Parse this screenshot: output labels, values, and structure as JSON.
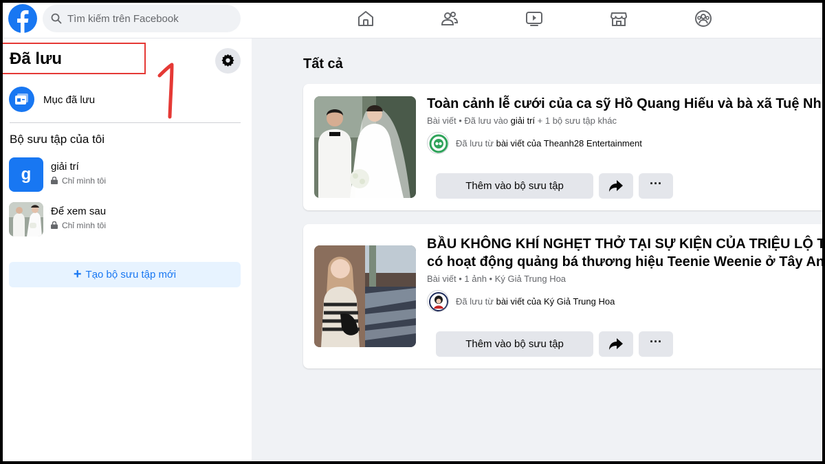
{
  "search": {
    "placeholder": "Tìm kiếm trên Facebook"
  },
  "nav": [
    "home-icon",
    "friends-icon",
    "watch-icon",
    "marketplace-icon",
    "groups-icon"
  ],
  "sidebar": {
    "title": "Đã lưu",
    "annotation_number": "1",
    "saved_items_label": "Mục đã lưu",
    "collections_heading": "Bộ sưu tập của tôi",
    "collections": [
      {
        "name": "giải trí",
        "thumb_letter": "g",
        "privacy": "Chỉ mình tôi"
      },
      {
        "name": "Để xem sau",
        "privacy": "Chỉ mình tôi"
      }
    ],
    "new_collection_label": "Tạo bộ sưu tập mới"
  },
  "main": {
    "title": "Tất cả",
    "posts": [
      {
        "title_lines": [
          "Toàn cảnh lễ cưới của ca sỹ Hồ Quang Hiếu và bà xã Tuệ Nhi"
        ],
        "meta_prefix": "Bài viết • Đã lưu vào ",
        "meta_bold": "giải trí",
        "meta_suffix": " + 1 bộ sưu tập khác",
        "source_prefix": "Đã lưu từ ",
        "source_bold": "bài viết của Theanh28 Entertainment",
        "add_label": "Thêm vào bộ sưu tập",
        "more_label": "···"
      },
      {
        "title_lines": [
          "BẦU KHÔNG KHÍ NGHẸT THỞ TẠI SỰ KIỆN CỦA TRIỆU LỘ TƯ",
          "có hoạt động quảng bá thương hiệu Teenie Weenie ở Tây An"
        ],
        "meta_prefix": "Bài viết • 1 ảnh • Ký Giả Trung Hoa",
        "source_prefix": "Đã lưu từ ",
        "source_bold": "bài viết của Ký Giả Trung Hoa",
        "add_label": "Thêm vào bộ sưu tập",
        "more_label": "···"
      }
    ]
  },
  "colors": {
    "brand": "#1877f2",
    "annotation": "#e53935",
    "background": "#f0f2f5"
  }
}
